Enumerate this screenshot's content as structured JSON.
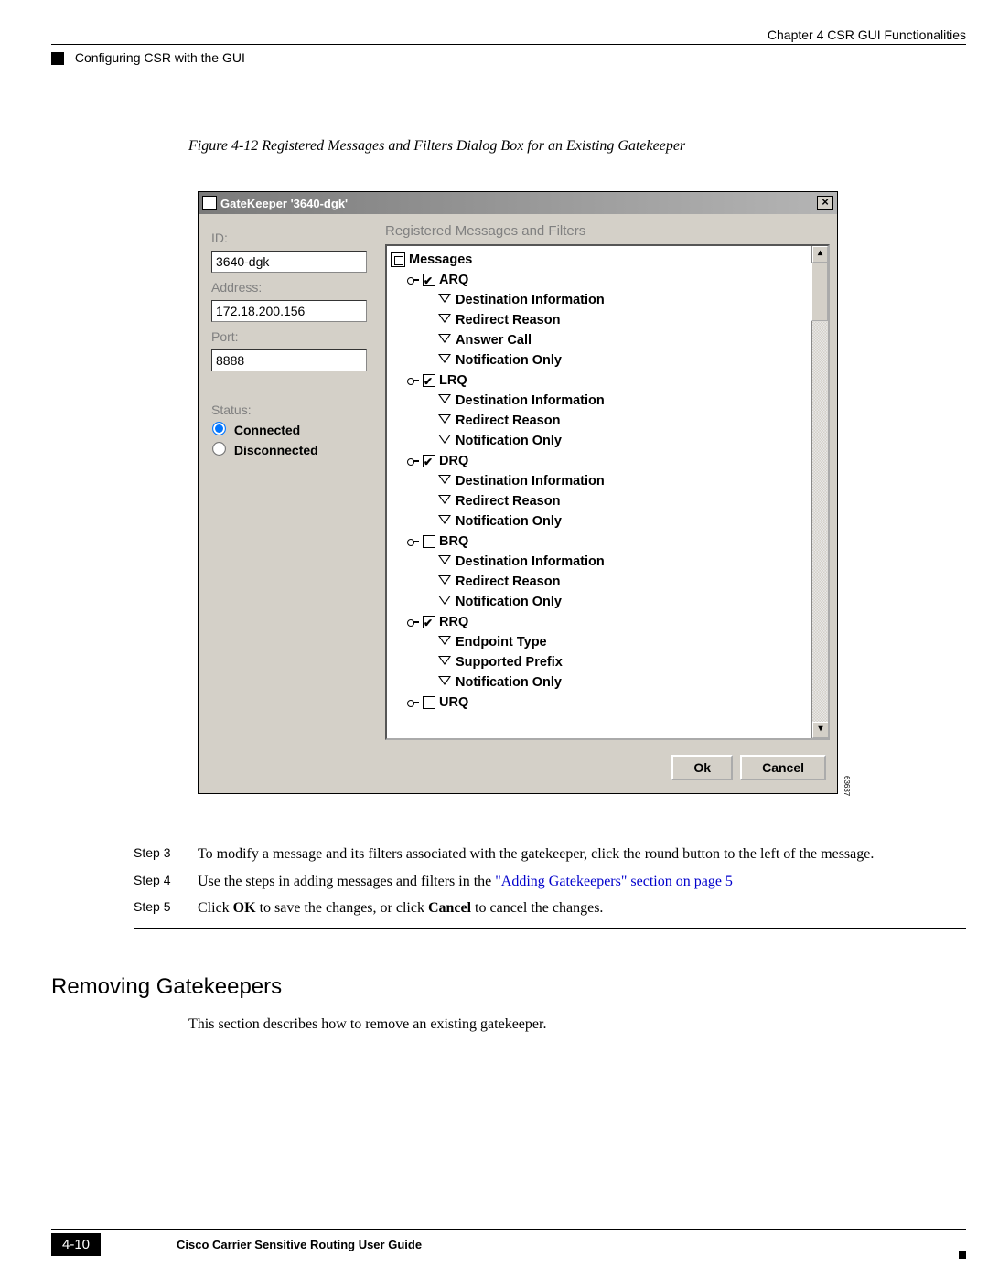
{
  "header": {
    "chapter": "Chapter 4    CSR GUI Functionalities",
    "breadcrumb": "Configuring CSR with the GUI"
  },
  "figure": {
    "caption": "Figure 4-12   Registered Messages and Filters Dialog Box for an Existing Gatekeeper",
    "image_ref": "63637"
  },
  "dialog": {
    "title": "GateKeeper '3640-dgk'",
    "close": "×",
    "labels": {
      "id": "ID:",
      "address": "Address:",
      "port": "Port:",
      "status": "Status:"
    },
    "fields": {
      "id": "3640-dgk",
      "address": "172.18.200.156",
      "port": "8888"
    },
    "status": {
      "connected": "Connected",
      "disconnected": "Disconnected",
      "selected": "connected"
    },
    "tree_heading": "Registered Messages and Filters",
    "root_label": "Messages",
    "messages": [
      {
        "name": "ARQ",
        "checked": true,
        "filters": [
          "Destination Information",
          "Redirect Reason",
          "Answer Call",
          "Notification Only"
        ]
      },
      {
        "name": "LRQ",
        "checked": true,
        "filters": [
          "Destination Information",
          "Redirect Reason",
          "Notification Only"
        ]
      },
      {
        "name": "DRQ",
        "checked": true,
        "filters": [
          "Destination Information",
          "Redirect Reason",
          "Notification Only"
        ]
      },
      {
        "name": "BRQ",
        "checked": false,
        "filters": [
          "Destination Information",
          "Redirect Reason",
          "Notification Only"
        ]
      },
      {
        "name": "RRQ",
        "checked": true,
        "filters": [
          "Endpoint Type",
          "Supported Prefix",
          "Notification Only"
        ]
      },
      {
        "name": "URQ",
        "checked": false,
        "filters": []
      }
    ],
    "buttons": {
      "ok": "Ok",
      "cancel": "Cancel"
    },
    "scroll": {
      "up": "▴",
      "down": "▾"
    }
  },
  "steps": {
    "s3_label": "Step 3",
    "s3_text": "To modify a message and its filters associated with the gatekeeper, click the round button to the left of the message.",
    "s4_label": "Step 4",
    "s4_pre": "Use the steps in adding messages and filters in the ",
    "s4_link": "\"Adding Gatekeepers\" section on page 5",
    "s5_label": "Step 5",
    "s5_pre": "Click ",
    "s5_ok": "OK",
    "s5_mid": " to save the changes, or click ",
    "s5_cancel": "Cancel",
    "s5_post": " to cancel the changes."
  },
  "section": {
    "heading": "Removing Gatekeepers",
    "body": "This section describes how to remove an existing gatekeeper."
  },
  "footer": {
    "page": "4-10",
    "title": "Cisco Carrier Sensitive Routing User Guide"
  }
}
